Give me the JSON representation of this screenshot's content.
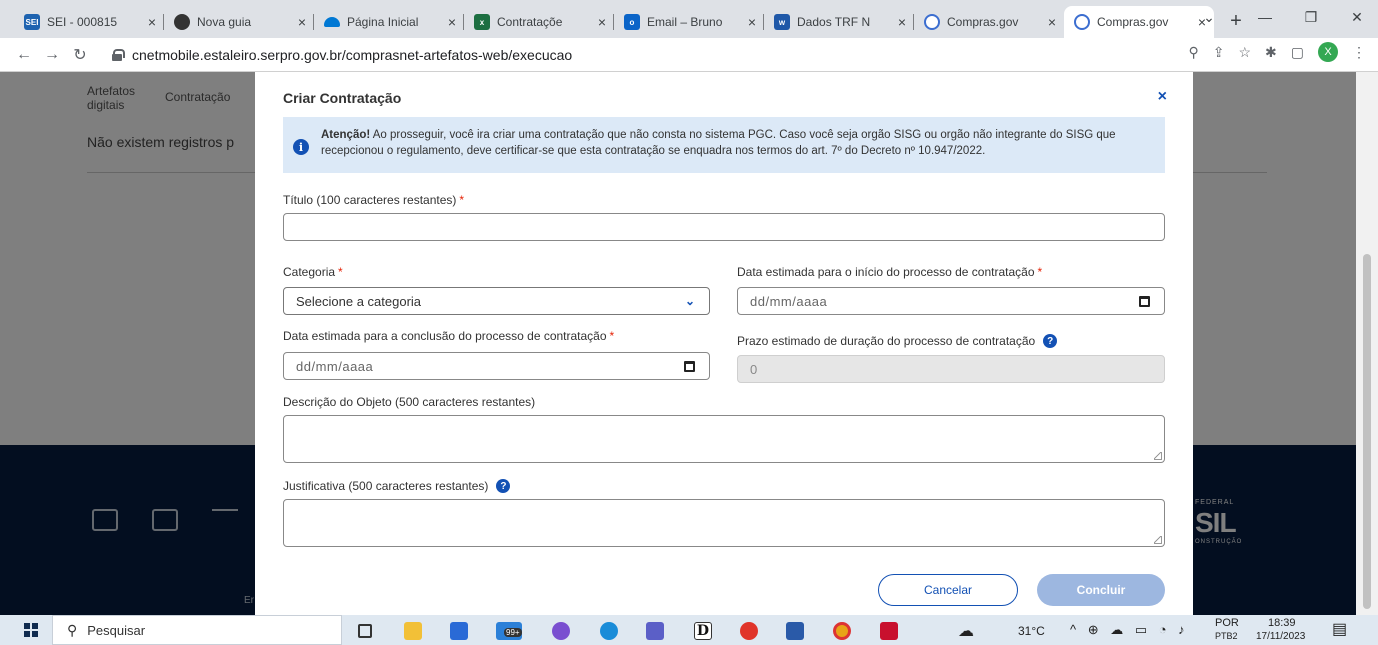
{
  "browser": {
    "tabs": [
      {
        "title": "SEI - 000815",
        "favicon": "SEI",
        "color": "#1e63b0"
      },
      {
        "title": "Nova guia",
        "favicon": "",
        "color": "#333333"
      },
      {
        "title": "Página Inicial",
        "favicon": "",
        "color": "#0078d4"
      },
      {
        "title": "Contrataçõe",
        "favicon": "x",
        "color": "#1d6f42"
      },
      {
        "title": "Email – Bruno",
        "favicon": "o",
        "color": "#0a64c8"
      },
      {
        "title": "Dados TRF N",
        "favicon": "w",
        "color": "#1f58a8"
      },
      {
        "title": "Compras.gov",
        "favicon": "",
        "color": "#3c6ed0"
      },
      {
        "title": "Compras.gov",
        "favicon": "",
        "color": "#3c6ed0",
        "active": true
      }
    ],
    "url": "cnetmobile.estaleiro.serpro.gov.br/comprasnet-artefatos-web/execucao",
    "profile_initial": "X"
  },
  "page": {
    "table_headers": [
      "Artefatos digitais",
      "Contratação"
    ],
    "empty_message": "Não existem registros p",
    "footer_logo_top": "FEDERAL",
    "footer_logo": "SIL",
    "footer_logo_sub": "ONSTRUÇÃO",
    "footer_text": "Er"
  },
  "modal": {
    "title": "Criar Contratação",
    "close": "×",
    "alert_bold": "Atenção!",
    "alert_text": " Ao prosseguir, você ira criar uma contratação que não consta no sistema PGC. Caso você seja orgão SISG ou orgão não integrante do SISG que recepcionou o regulamento, deve certificar-se que esta contratação se enquadra nos termos do art. 7º do Decreto nº 10.947/2022.",
    "titulo_label": "Título (100 caracteres restantes)",
    "categoria_label": "Categoria",
    "categoria_value": "Selecione a categoria",
    "data_inicio_label": "Data estimada para o início do processo de contratação",
    "data_inicio_placeholder": "dd/mm/aaaa",
    "data_conclusao_label": "Data estimada para a conclusão do processo de contratação",
    "data_conclusao_placeholder": "dd/mm/aaaa",
    "prazo_label": "Prazo estimado de duração do processo de contratação",
    "prazo_value": "0",
    "descricao_label": "Descrição do Objeto (500 caracteres restantes)",
    "justificativa_label": "Justificativa (500 caracteres restantes)",
    "required_mark": "*",
    "cancel_label": "Cancelar",
    "confirm_label": "Concluir"
  },
  "taskbar": {
    "search_placeholder": "Pesquisar",
    "weather": "31°C",
    "language": "POR",
    "language_sub": "PTB2",
    "time": "18:39",
    "date": "17/11/2023",
    "badge": "99+"
  }
}
